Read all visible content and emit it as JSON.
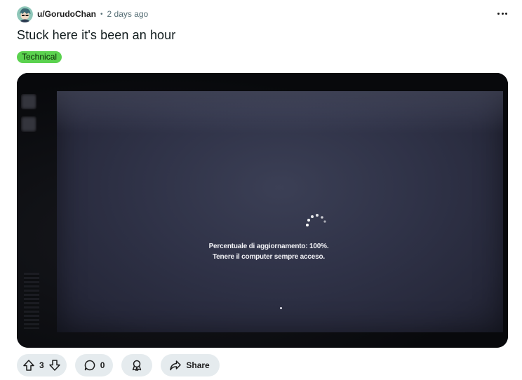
{
  "post": {
    "author": "u/GorudoChan",
    "separator": "•",
    "timestamp": "2 days ago",
    "title": "Stuck here it's been an hour",
    "flair": "Technical",
    "flair_color": "#5bd24f",
    "more_icon": "more-horizontal-icon"
  },
  "media": {
    "screen_line1": "Percentuale di aggiornamento: 100%.",
    "screen_line2": "Tenere il computer sempre acceso."
  },
  "actions": {
    "upvote_icon": "arrow-up-icon",
    "vote_count": "3",
    "downvote_icon": "arrow-down-icon",
    "comment_icon": "comment-bubble-icon",
    "comment_count": "0",
    "award_icon": "award-icon",
    "share_icon": "share-arrow-icon",
    "share_label": "Share",
    "pill_background": "#e5ebee"
  }
}
